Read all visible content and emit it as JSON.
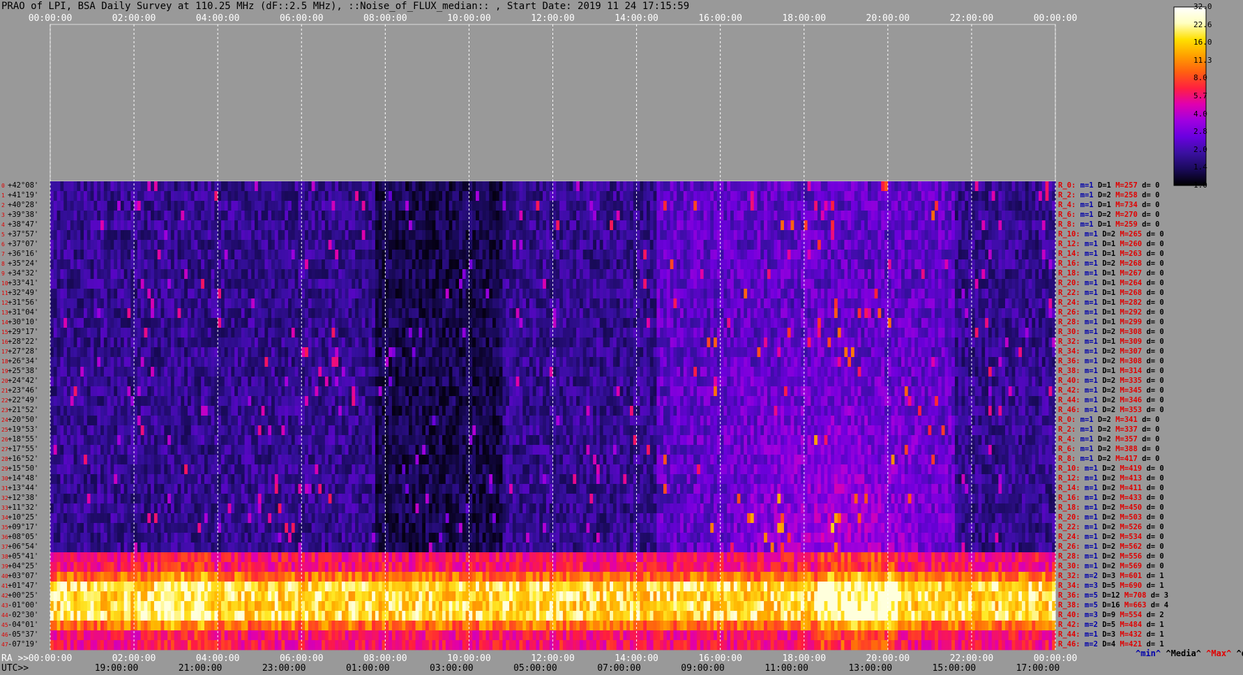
{
  "title": "PRAO of LPI, BSA Daily Survey at 110.25 MHz (dF::2.5 MHz), ::Noise_of_FLUX_median:: , Start Date: 2019 11 24 17:15:59",
  "chart_data": {
    "type": "heatmap",
    "title": "PRAO of LPI, BSA Daily Survey at 110.25 MHz (dF::2.5 MHz), ::Noise_of_FLUX_median:: , Start Date: 2019 11 24 17:15:59",
    "x_top_ticks": [
      "00:00:00",
      "02:00:00",
      "04:00:00",
      "06:00:00",
      "08:00:00",
      "10:00:00",
      "12:00:00",
      "14:00:00",
      "16:00:00",
      "18:00:00",
      "20:00:00",
      "22:00:00",
      "00:00:00"
    ],
    "ra_prefix": "RA >>",
    "x_ra_ticks": [
      "00:00:00",
      "02:00:00",
      "04:00:00",
      "06:00:00",
      "08:00:00",
      "10:00:00",
      "12:00:00",
      "14:00:00",
      "16:00:00",
      "18:00:00",
      "20:00:00",
      "22:00:00",
      "00:00:00"
    ],
    "utc_prefix": "UTC>>",
    "x_utc_ticks": [
      "19:00:00",
      "21:00:00",
      "23:00:00",
      "01:00:00",
      "03:00:00",
      "05:00:00",
      "07:00:00",
      "09:00:00",
      "11:00:00",
      "13:00:00",
      "15:00:00",
      "17:00:00"
    ],
    "colorbar": {
      "ticks": [
        "32.0",
        "22.6",
        "16.0",
        "11.3",
        "8.0",
        "5.7",
        "4.0",
        "2.8",
        "2.0",
        "1.4",
        "1.0"
      ],
      "colors": [
        "#000000",
        "#1a0a5a",
        "#3a10a0",
        "#6a00e0",
        "#a000e0",
        "#e000b0",
        "#ff2040",
        "#ff6010",
        "#ffa000",
        "#ffe000",
        "#ffffc0",
        "#ffffff"
      ]
    },
    "rows": [
      {
        "i": "0",
        "dec": "+42°08'",
        "r": "R_0:",
        "m": "m=1",
        "d": "D=1",
        "M": "M=257",
        "dev": "d= 0"
      },
      {
        "i": "1",
        "dec": "+41°19'",
        "r": "R_2:",
        "m": "m=1",
        "d": "D=2",
        "M": "M=258",
        "dev": "d= 0"
      },
      {
        "i": "2",
        "dec": "+40°28'",
        "r": "R_4:",
        "m": "m=1",
        "d": "D=1",
        "M": "M=734",
        "dev": "d= 0"
      },
      {
        "i": "3",
        "dec": "+39°38'",
        "r": "R_6:",
        "m": "m=1",
        "d": "D=2",
        "M": "M=270",
        "dev": "d= 0"
      },
      {
        "i": "4",
        "dec": "+38°47'",
        "r": "R_8:",
        "m": "m=1",
        "d": "D=1",
        "M": "M=259",
        "dev": "d= 0"
      },
      {
        "i": "5",
        "dec": "+37°57'",
        "r": "R_10:",
        "m": "m=1",
        "d": "D=2",
        "M": "M=265",
        "dev": "d= 0"
      },
      {
        "i": "6",
        "dec": "+37°07'",
        "r": "R_12:",
        "m": "m=1",
        "d": "D=1",
        "M": "M=260",
        "dev": "d= 0"
      },
      {
        "i": "7",
        "dec": "+36°16'",
        "r": "R_14:",
        "m": "m=1",
        "d": "D=1",
        "M": "M=263",
        "dev": "d= 0"
      },
      {
        "i": "8",
        "dec": "+35°24'",
        "r": "R_16:",
        "m": "m=1",
        "d": "D=2",
        "M": "M=268",
        "dev": "d= 0"
      },
      {
        "i": "9",
        "dec": "+34°32'",
        "r": "R_18:",
        "m": "m=1",
        "d": "D=1",
        "M": "M=267",
        "dev": "d= 0"
      },
      {
        "i": "10",
        "dec": "+33°41'",
        "r": "R_20:",
        "m": "m=1",
        "d": "D=1",
        "M": "M=264",
        "dev": "d= 0"
      },
      {
        "i": "11",
        "dec": "+32°49'",
        "r": "R_22:",
        "m": "m=1",
        "d": "D=1",
        "M": "M=268",
        "dev": "d= 0"
      },
      {
        "i": "12",
        "dec": "+31°56'",
        "r": "R_24:",
        "m": "m=1",
        "d": "D=1",
        "M": "M=282",
        "dev": "d= 0"
      },
      {
        "i": "13",
        "dec": "+31°04'",
        "r": "R_26:",
        "m": "m=1",
        "d": "D=1",
        "M": "M=292",
        "dev": "d= 0"
      },
      {
        "i": "14",
        "dec": "+30°10'",
        "r": "R_28:",
        "m": "m=1",
        "d": "D=1",
        "M": "M=299",
        "dev": "d= 0"
      },
      {
        "i": "15",
        "dec": "+29°17'",
        "r": "R_30:",
        "m": "m=1",
        "d": "D=2",
        "M": "M=308",
        "dev": "d= 0"
      },
      {
        "i": "16",
        "dec": "+28°22'",
        "r": "R_32:",
        "m": "m=1",
        "d": "D=1",
        "M": "M=309",
        "dev": "d= 0"
      },
      {
        "i": "17",
        "dec": "+27°28'",
        "r": "R_34:",
        "m": "m=1",
        "d": "D=2",
        "M": "M=307",
        "dev": "d= 0"
      },
      {
        "i": "18",
        "dec": "+26°34'",
        "r": "R_36:",
        "m": "m=1",
        "d": "D=2",
        "M": "M=308",
        "dev": "d= 0"
      },
      {
        "i": "19",
        "dec": "+25°38'",
        "r": "R_38:",
        "m": "m=1",
        "d": "D=1",
        "M": "M=314",
        "dev": "d= 0"
      },
      {
        "i": "20",
        "dec": "+24°42'",
        "r": "R_40:",
        "m": "m=1",
        "d": "D=2",
        "M": "M=335",
        "dev": "d= 0"
      },
      {
        "i": "21",
        "dec": "+23°46'",
        "r": "R_42:",
        "m": "m=1",
        "d": "D=2",
        "M": "M=345",
        "dev": "d= 0"
      },
      {
        "i": "22",
        "dec": "+22°49'",
        "r": "R_44:",
        "m": "m=1",
        "d": "D=2",
        "M": "M=346",
        "dev": "d= 0"
      },
      {
        "i": "23",
        "dec": "+21°52'",
        "r": "R_46:",
        "m": "m=1",
        "d": "D=2",
        "M": "M=353",
        "dev": "d= 0"
      },
      {
        "i": "24",
        "dec": "+20°50'",
        "r": "R_0:",
        "m": "m=1",
        "d": "D=2",
        "M": "M=341",
        "dev": "d= 0"
      },
      {
        "i": "25",
        "dec": "+19°53'",
        "r": "R_2:",
        "m": "m=1",
        "d": "D=2",
        "M": "M=337",
        "dev": "d= 0"
      },
      {
        "i": "26",
        "dec": "+18°55'",
        "r": "R_4:",
        "m": "m=1",
        "d": "D=2",
        "M": "M=357",
        "dev": "d= 0"
      },
      {
        "i": "27",
        "dec": "+17°55'",
        "r": "R_6:",
        "m": "m=1",
        "d": "D=2",
        "M": "M=388",
        "dev": "d= 0"
      },
      {
        "i": "28",
        "dec": "+16°52'",
        "r": "R_8:",
        "m": "m=1",
        "d": "D=2",
        "M": "M=417",
        "dev": "d= 0"
      },
      {
        "i": "29",
        "dec": "+15°50'",
        "r": "R_10:",
        "m": "m=1",
        "d": "D=2",
        "M": "M=419",
        "dev": "d= 0"
      },
      {
        "i": "30",
        "dec": "+14°48'",
        "r": "R_12:",
        "m": "m=1",
        "d": "D=2",
        "M": "M=413",
        "dev": "d= 0"
      },
      {
        "i": "31",
        "dec": "+13°44'",
        "r": "R_14:",
        "m": "m=1",
        "d": "D=2",
        "M": "M=411",
        "dev": "d= 0"
      },
      {
        "i": "32",
        "dec": "+12°38'",
        "r": "R_16:",
        "m": "m=1",
        "d": "D=2",
        "M": "M=433",
        "dev": "d= 0"
      },
      {
        "i": "33",
        "dec": "+11°32'",
        "r": "R_18:",
        "m": "m=1",
        "d": "D=2",
        "M": "M=450",
        "dev": "d= 0"
      },
      {
        "i": "34",
        "dec": "+10°25'",
        "r": "R_20:",
        "m": "m=1",
        "d": "D=2",
        "M": "M=503",
        "dev": "d= 0"
      },
      {
        "i": "35",
        "dec": "+09°17'",
        "r": "R_22:",
        "m": "m=1",
        "d": "D=2",
        "M": "M=526",
        "dev": "d= 0"
      },
      {
        "i": "36",
        "dec": "+08°05'",
        "r": "R_24:",
        "m": "m=1",
        "d": "D=2",
        "M": "M=534",
        "dev": "d= 0"
      },
      {
        "i": "37",
        "dec": "+06°54'",
        "r": "R_26:",
        "m": "m=1",
        "d": "D=2",
        "M": "M=562",
        "dev": "d= 0"
      },
      {
        "i": "38",
        "dec": "+05°41'",
        "r": "R_28:",
        "m": "m=1",
        "d": "D=2",
        "M": "M=556",
        "dev": "d= 0"
      },
      {
        "i": "39",
        "dec": "+04°25'",
        "r": "R_30:",
        "m": "m=1",
        "d": "D=2",
        "M": "M=569",
        "dev": "d= 0"
      },
      {
        "i": "40",
        "dec": "+03°07'",
        "r": "R_32:",
        "m": "m=2",
        "d": "D=3",
        "M": "M=601",
        "dev": "d= 1"
      },
      {
        "i": "41",
        "dec": "+01°47'",
        "r": "R_34:",
        "m": "m=3",
        "d": "D=5",
        "M": "M=690",
        "dev": "d= 1"
      },
      {
        "i": "42",
        "dec": "+00°25'",
        "r": "R_36:",
        "m": "m=5",
        "d": "D=12",
        "M": "M=708",
        "dev": "d= 3"
      },
      {
        "i": "43",
        "dec": "-01°00'",
        "r": "R_38:",
        "m": "m=5",
        "d": "D=16",
        "M": "M=663",
        "dev": "d= 4"
      },
      {
        "i": "44",
        "dec": "-02°30'",
        "r": "R_40:",
        "m": "m=3",
        "d": "D=9",
        "M": "M=554",
        "dev": "d= 2"
      },
      {
        "i": "45",
        "dec": "-04°01'",
        "r": "R_42:",
        "m": "m=2",
        "d": "D=5",
        "M": "M=484",
        "dev": "d= 1"
      },
      {
        "i": "46",
        "dec": "-05°37'",
        "r": "R_44:",
        "m": "m=1",
        "d": "D=3",
        "M": "M=432",
        "dev": "d= 1"
      },
      {
        "i": "47",
        "dec": "-07°19'",
        "r": "R_46:",
        "m": "m=2",
        "d": "D=4",
        "M": "M=421",
        "dev": "d= 1"
      }
    ],
    "stats_legend": {
      "min": "^min^",
      "median": "^Media^",
      "max": "^Max^",
      "dev": "^devia^"
    }
  }
}
